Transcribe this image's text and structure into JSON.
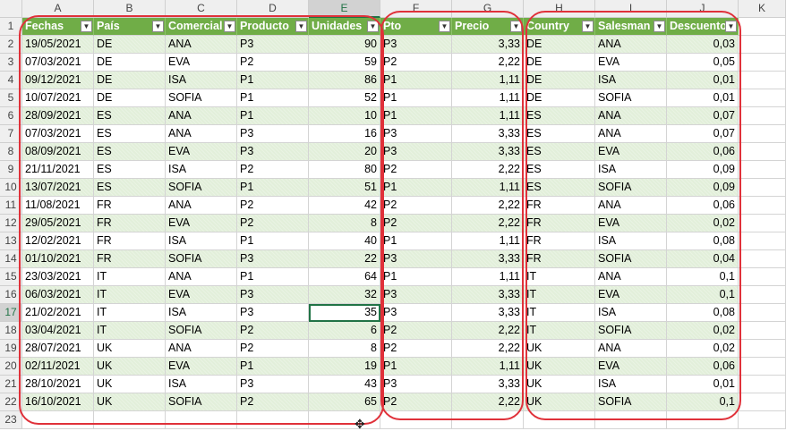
{
  "sheet": {
    "column_letters": [
      "A",
      "B",
      "C",
      "D",
      "E",
      "F",
      "G",
      "H",
      "I",
      "J",
      "K"
    ],
    "selected_column": "E",
    "selected_row": "17",
    "row_numbers": [
      "1",
      "2",
      "3",
      "4",
      "5",
      "6",
      "7",
      "8",
      "9",
      "10",
      "11",
      "12",
      "13",
      "14",
      "15",
      "16",
      "17",
      "18",
      "19",
      "20",
      "21",
      "22",
      "23"
    ]
  },
  "table1": {
    "headers": [
      "Fechas",
      "País",
      "Comercial",
      "Producto",
      "Unidades"
    ],
    "rows": [
      [
        "19/05/2021",
        "DE",
        "ANA",
        "P3",
        "90"
      ],
      [
        "07/03/2021",
        "DE",
        "EVA",
        "P2",
        "59"
      ],
      [
        "09/12/2021",
        "DE",
        "ISA",
        "P1",
        "86"
      ],
      [
        "10/07/2021",
        "DE",
        "SOFIA",
        "P1",
        "52"
      ],
      [
        "28/09/2021",
        "ES",
        "ANA",
        "P1",
        "10"
      ],
      [
        "07/03/2021",
        "ES",
        "ANA",
        "P3",
        "16"
      ],
      [
        "08/09/2021",
        "ES",
        "EVA",
        "P3",
        "20"
      ],
      [
        "21/11/2021",
        "ES",
        "ISA",
        "P2",
        "80"
      ],
      [
        "13/07/2021",
        "ES",
        "SOFIA",
        "P1",
        "51"
      ],
      [
        "11/08/2021",
        "FR",
        "ANA",
        "P2",
        "42"
      ],
      [
        "29/05/2021",
        "FR",
        "EVA",
        "P2",
        "8"
      ],
      [
        "12/02/2021",
        "FR",
        "ISA",
        "P1",
        "40"
      ],
      [
        "01/10/2021",
        "FR",
        "SOFIA",
        "P3",
        "22"
      ],
      [
        "23/03/2021",
        "IT",
        "ANA",
        "P1",
        "64"
      ],
      [
        "06/03/2021",
        "IT",
        "EVA",
        "P3",
        "32"
      ],
      [
        "21/02/2021",
        "IT",
        "ISA",
        "P3",
        "35"
      ],
      [
        "03/04/2021",
        "IT",
        "SOFIA",
        "P2",
        "6"
      ],
      [
        "28/07/2021",
        "UK",
        "ANA",
        "P2",
        "8"
      ],
      [
        "02/11/2021",
        "UK",
        "EVA",
        "P1",
        "19"
      ],
      [
        "28/10/2021",
        "UK",
        "ISA",
        "P3",
        "43"
      ],
      [
        "16/10/2021",
        "UK",
        "SOFIA",
        "P2",
        "65"
      ]
    ]
  },
  "table2": {
    "headers": [
      "Pto",
      "Precio"
    ],
    "rows": [
      [
        "P3",
        "3,33"
      ],
      [
        "P2",
        "2,22"
      ],
      [
        "P1",
        "1,11"
      ],
      [
        "P1",
        "1,11"
      ],
      [
        "P1",
        "1,11"
      ],
      [
        "P3",
        "3,33"
      ],
      [
        "P3",
        "3,33"
      ],
      [
        "P2",
        "2,22"
      ],
      [
        "P1",
        "1,11"
      ],
      [
        "P2",
        "2,22"
      ],
      [
        "P2",
        "2,22"
      ],
      [
        "P1",
        "1,11"
      ],
      [
        "P3",
        "3,33"
      ],
      [
        "P1",
        "1,11"
      ],
      [
        "P3",
        "3,33"
      ],
      [
        "P3",
        "3,33"
      ],
      [
        "P2",
        "2,22"
      ],
      [
        "P2",
        "2,22"
      ],
      [
        "P1",
        "1,11"
      ],
      [
        "P3",
        "3,33"
      ],
      [
        "P2",
        "2,22"
      ]
    ]
  },
  "table3": {
    "headers": [
      "Country",
      "Salesman",
      "Descuento"
    ],
    "rows": [
      [
        "DE",
        "ANA",
        "0,03"
      ],
      [
        "DE",
        "EVA",
        "0,05"
      ],
      [
        "DE",
        "ISA",
        "0,01"
      ],
      [
        "DE",
        "SOFIA",
        "0,01"
      ],
      [
        "ES",
        "ANA",
        "0,07"
      ],
      [
        "ES",
        "ANA",
        "0,07"
      ],
      [
        "ES",
        "EVA",
        "0,06"
      ],
      [
        "ES",
        "ISA",
        "0,09"
      ],
      [
        "ES",
        "SOFIA",
        "0,09"
      ],
      [
        "FR",
        "ANA",
        "0,06"
      ],
      [
        "FR",
        "EVA",
        "0,02"
      ],
      [
        "FR",
        "ISA",
        "0,08"
      ],
      [
        "FR",
        "SOFIA",
        "0,04"
      ],
      [
        "IT",
        "ANA",
        "0,1"
      ],
      [
        "IT",
        "EVA",
        "0,1"
      ],
      [
        "IT",
        "ISA",
        "0,08"
      ],
      [
        "IT",
        "SOFIA",
        "0,02"
      ],
      [
        "UK",
        "ANA",
        "0,02"
      ],
      [
        "UK",
        "EVA",
        "0,06"
      ],
      [
        "UK",
        "ISA",
        "0,01"
      ],
      [
        "UK",
        "SOFIA",
        "0,1"
      ]
    ]
  },
  "icons": {
    "filter_dropdown": "chevron-down-icon",
    "cursor": "move-cursor-icon"
  },
  "colors": {
    "header_green": "#70ad47",
    "band_green": "#e2efda",
    "selection_green": "#217346",
    "annotation_red": "#e0313a"
  }
}
